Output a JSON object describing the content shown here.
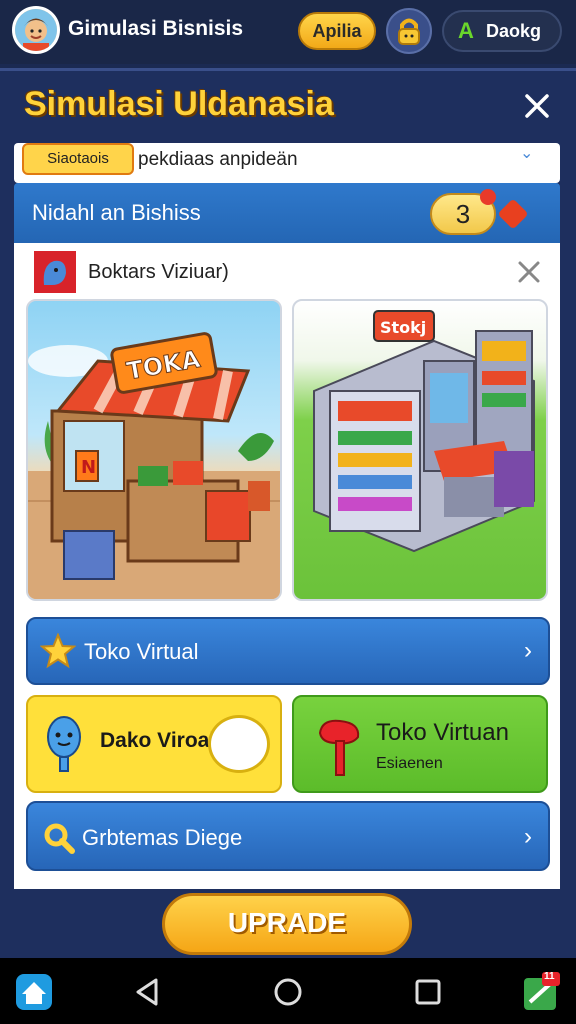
{
  "header": {
    "app_title": "Gimulasi Bisnisis",
    "apilia_label": "Apilia",
    "profile_label": "Daokg",
    "profile_letter": "A"
  },
  "panel": {
    "title": "Simulasi Uldanasia",
    "strip_chip": "Siaotaois",
    "strip_text": "pekdiaas anpideän",
    "section_label": "Nidahl an Bishiss",
    "badge_count": "3",
    "list_header": "Boktars Viziuar)",
    "image_left_sign": "TOKA",
    "image_right_sign": "Stokj",
    "row_label": "Toko Virtual",
    "tile_yellow_label": "Dako Viroak",
    "tile_green_label": "Toko Virtuan",
    "tile_green_sub": "Esiaenen",
    "search_label": "Grbtemas Diege",
    "upgrade_label": "UPRADE"
  },
  "colors": {
    "accent_yellow": "#ffd23a",
    "accent_blue": "#2f79cc",
    "accent_green": "#6bc23a",
    "nav_badge": "#e8232a"
  },
  "navbar": {
    "badge_count": "11"
  }
}
